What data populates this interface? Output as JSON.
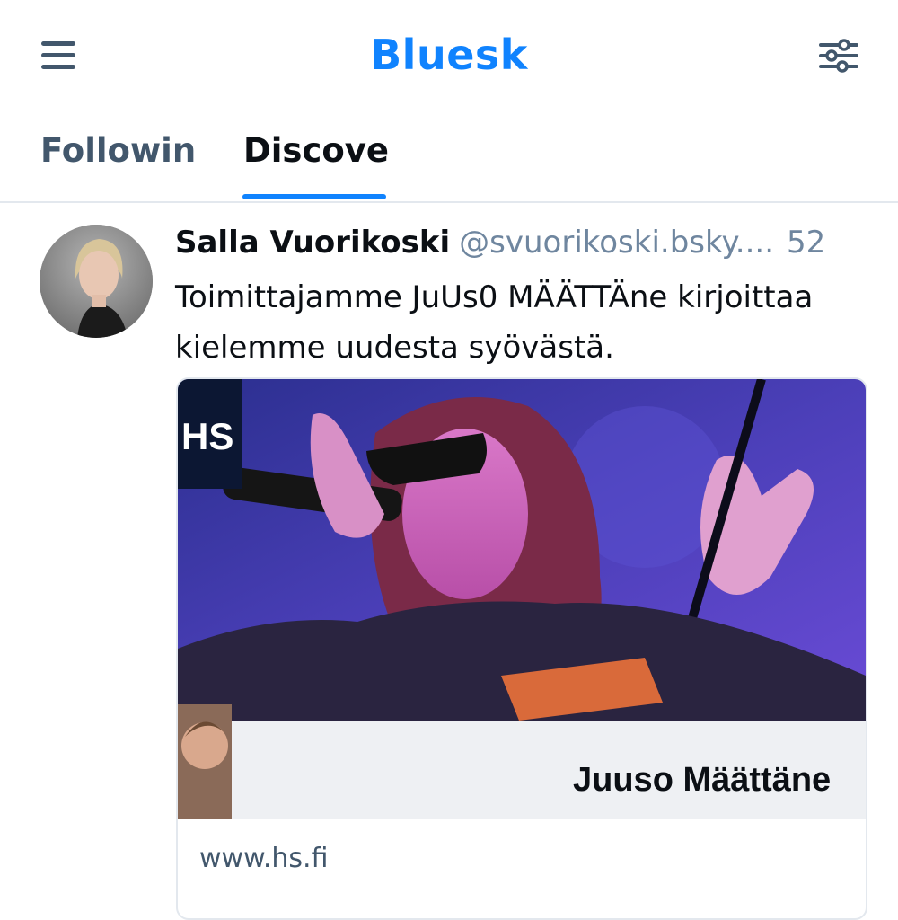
{
  "header": {
    "title": "Bluesk",
    "menu_icon": "hamburger-menu-icon",
    "filter_icon": "sliders-icon",
    "accent_color": "#1083fe"
  },
  "tabs": [
    {
      "label": "Followin",
      "active": false
    },
    {
      "label": "Discove",
      "active": true
    }
  ],
  "post": {
    "author_name": "Salla Vuorikoski",
    "author_handle": "@svuorikoski.bsky....",
    "time": "52",
    "text_line1": "Toimittajamme JuUs0 MÄÄTTÄne kirjoittaa",
    "text_line2": "kielemme uudesta syövästä.",
    "link_card": {
      "logo_text": "HS",
      "banner_name": "Juuso Määttäne",
      "domain": "www.hs.fi"
    }
  }
}
